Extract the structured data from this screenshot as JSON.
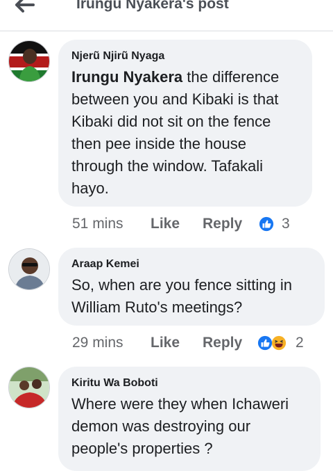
{
  "header": {
    "title": "Irungu Nyakera's post",
    "back_icon": "arrow-left-icon"
  },
  "comments": [
    {
      "author": "Njerũ Njirũ Nyaga",
      "mention": "Irungu Nyakera",
      "text": " the difference between you and Kibaki is that Kibaki did not sit on the fence then pee inside the house through the window. Tafakali hayo.",
      "time": "51 mins",
      "like_label": "Like",
      "reply_label": "Reply",
      "reactions": [
        "like-reaction-icon"
      ],
      "reaction_count": "3"
    },
    {
      "author": "Araap Kemei",
      "text": "So, when are you fence sitting in William Ruto's meetings?",
      "time": "29 mins",
      "like_label": "Like",
      "reply_label": "Reply",
      "reactions": [
        "like-reaction-icon",
        "haha-reaction-icon"
      ],
      "reaction_count": "2"
    },
    {
      "author": "Kiritu Wa Boboti",
      "text": "Where were they when Ichaweri demon was  destroying our people's properties ?"
    }
  ],
  "colors": {
    "bubble_bg": "#f0f2f5",
    "like_blue": "#1877f2",
    "haha_yellow": "#f7b125",
    "meta_gray": "#65676b"
  }
}
